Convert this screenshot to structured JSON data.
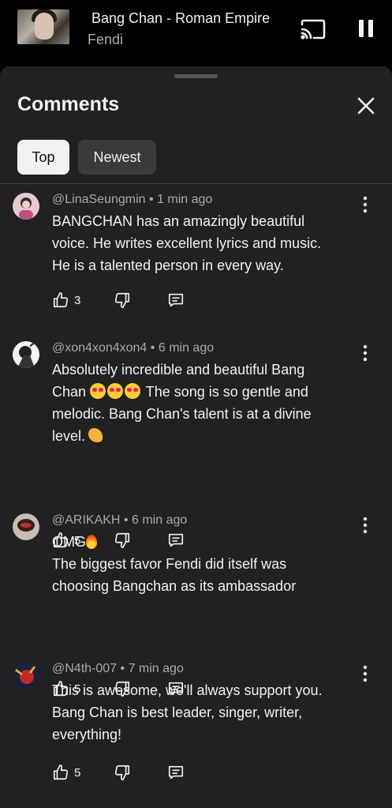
{
  "mini_player": {
    "title": "Bang Chan - Roman Empire",
    "subtitle": "Fendi",
    "cast_icon": "cast-icon",
    "pause_icon": "pause-icon"
  },
  "sheet": {
    "title": "Comments",
    "close_icon": "close-icon",
    "chips": {
      "top": "Top",
      "newest": "Newest"
    }
  },
  "comments": [
    {
      "author": "@LinaSeungmin",
      "time": "1 min ago",
      "lines": [
        "BANGCHAN has an amazingly beautiful",
        "voice. He writes excellent lyrics and music.",
        "He is a talented person in every way."
      ],
      "likes": "3"
    },
    {
      "author": "@xon4xon4xon4",
      "time": "6 min ago",
      "lines": [
        "Absolutely incredible and beautiful Bang",
        "Chan",
        "The song is so gentle and",
        "melodic. Bang Chan's talent is at a divine",
        "level."
      ],
      "likes": "5"
    },
    {
      "author": "@ARIKAKH",
      "time": "6 min ago",
      "lines": [
        "OMG",
        "The biggest favor Fendi did itself was",
        "choosing Bangchan as its ambassador"
      ],
      "likes": "5"
    },
    {
      "author": "@N4th-007",
      "time": "7 min ago",
      "lines": [
        "This is awesome, we'll always support you.",
        "Bang Chan is best leader, singer, writer,",
        "everything!"
      ],
      "likes": "5"
    }
  ],
  "separator": "•",
  "colors": {
    "sheet_bg": "#212121",
    "text": "#f1f1f1",
    "muted": "#aaaaaa",
    "chip_active": "#f1f1f1",
    "chip_inactive": "#3a3a3a"
  }
}
